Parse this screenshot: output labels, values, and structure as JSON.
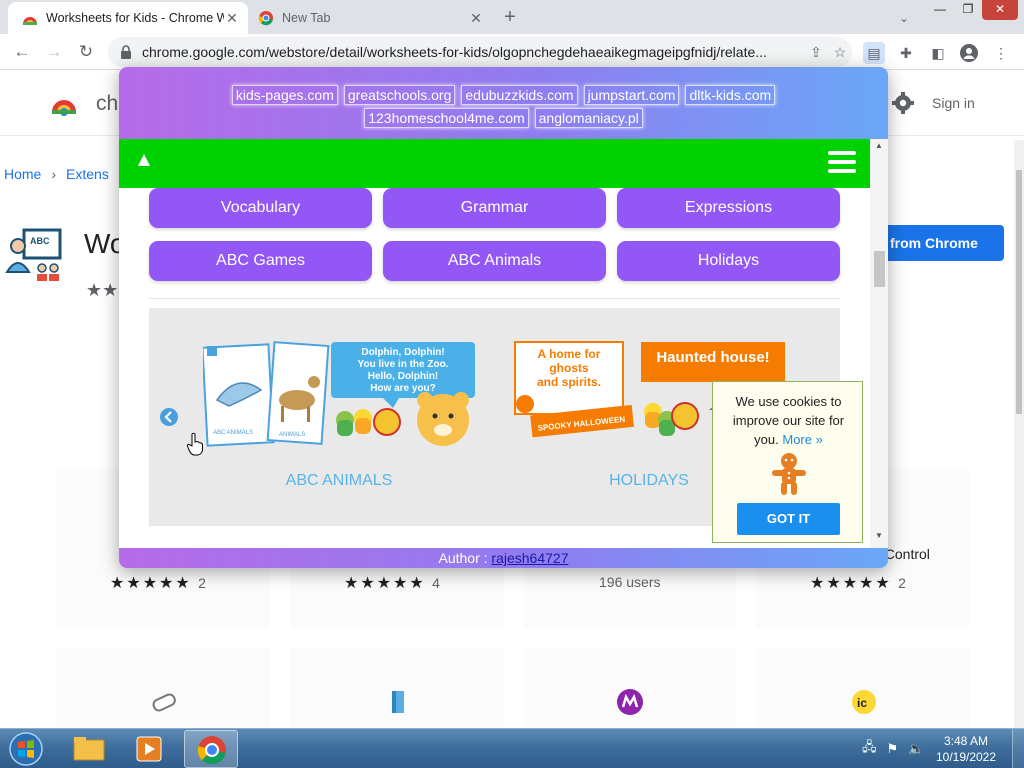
{
  "browser": {
    "active_tab_title": "Worksheets for Kids - Chrome W",
    "inactive_tab_title": "New Tab",
    "url": "chrome.google.com/webstore/detail/worksheets-for-kids/olgopnchegdehaeaikegmageipgfnidj/relate..."
  },
  "webstore": {
    "brand": "ch",
    "signin": "Sign in",
    "breadcrumb": [
      "Home",
      "Extens"
    ],
    "ext_title": "Wo",
    "ext_stars": "★★",
    "remove_button": "from Chrome",
    "cards": [
      {
        "stars": "★★★★★",
        "count": "2"
      },
      {
        "stars": "★★★★★",
        "count": "4"
      },
      {
        "users": "196 users"
      },
      {
        "name": "al Control",
        "stars": "★★★★★",
        "count": "2"
      }
    ]
  },
  "popup": {
    "links_row1": [
      "kids-pages.com",
      "greatschools.org",
      "edubuzzkids.com",
      "jumpstart.com",
      "dltk-kids.com"
    ],
    "links_row2": [
      "123homeschool4me.com",
      "anglomaniacy.pl"
    ],
    "categories": [
      "Vocabulary",
      "Grammar",
      "Expressions",
      "ABC Games",
      "ABC Animals",
      "Holidays"
    ],
    "slides": [
      {
        "title": "ABC ANIMALS",
        "speech": [
          "Dolphin, Dolphin!",
          "You live in the Zoo.",
          "Hello, Dolphin!",
          "How are you?"
        ],
        "card_label": "ABC ANIMALS",
        "card_label_2": "ANIMALS"
      },
      {
        "title": "HOLIDAYS",
        "note": [
          "A home for",
          "ghosts",
          "and spirits."
        ],
        "banner": "Haunted house!",
        "tag": "SPOOKY HALLOWEEN"
      }
    ],
    "footer_label": "Author : ",
    "footer_author": "rajesh64727",
    "colors": {
      "nav": "#00d100",
      "button": "#9357f5",
      "slide_title": "#5ab3e6"
    }
  },
  "cookie": {
    "message": "We use cookies to improve our site for you.",
    "more": "More »",
    "button": "GOT IT"
  },
  "taskbar": {
    "time": "3:48 AM",
    "date": "10/19/2022"
  }
}
